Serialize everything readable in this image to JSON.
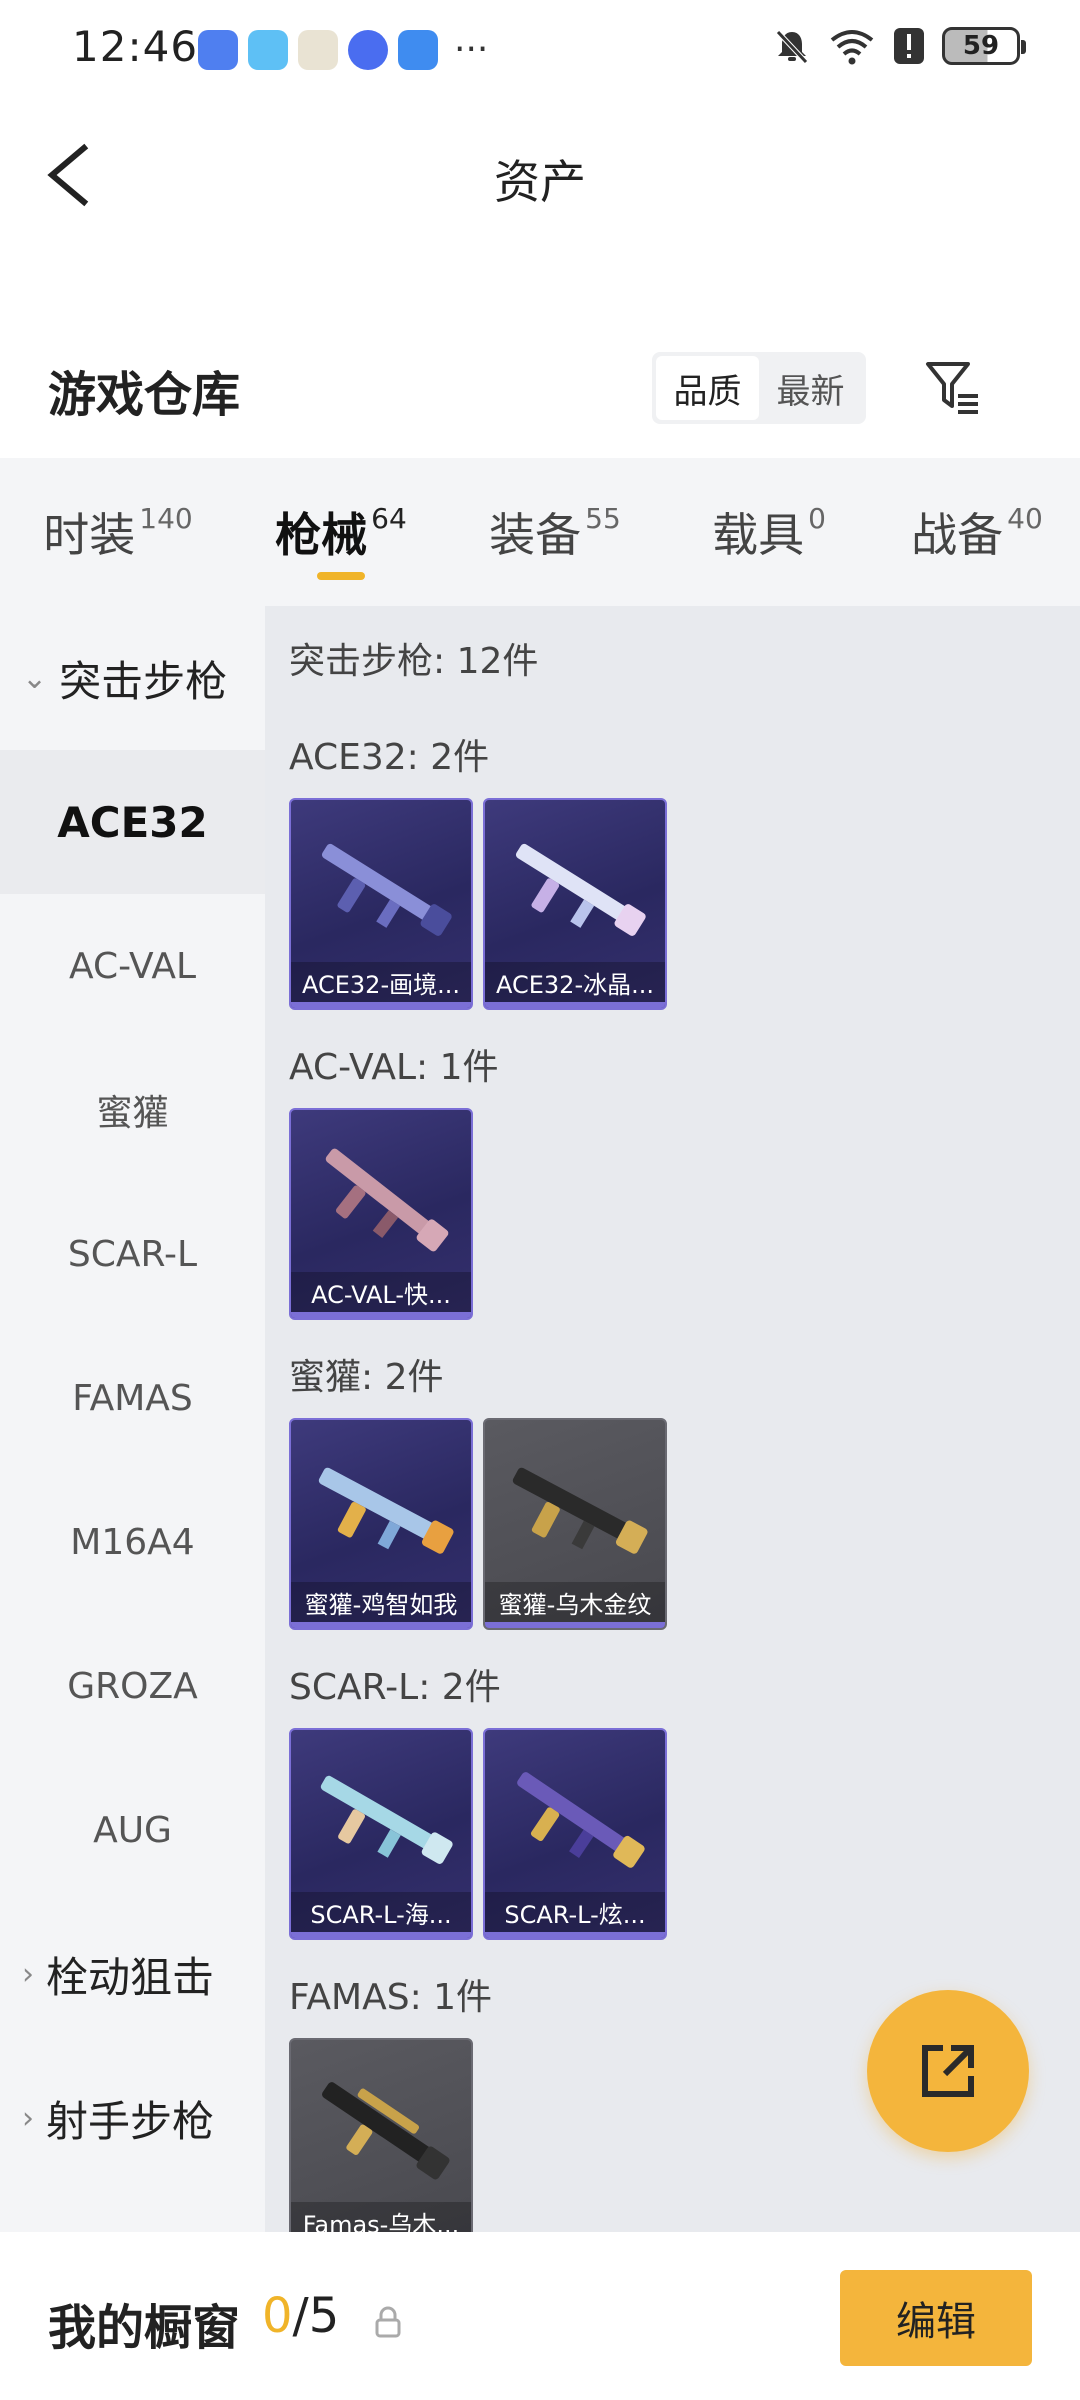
{
  "status_bar": {
    "time": "12:46",
    "battery": "59",
    "more": "···"
  },
  "header": {
    "title": "资产"
  },
  "warehouse": {
    "title": "游戏仓库",
    "sort_quality": "品质",
    "sort_latest": "最新"
  },
  "tabs": [
    {
      "label": "时装",
      "count": "140"
    },
    {
      "label": "枪械",
      "count": "64"
    },
    {
      "label": "装备",
      "count": "55"
    },
    {
      "label": "载具",
      "count": "0"
    },
    {
      "label": "战备",
      "count": "40"
    }
  ],
  "sidebar": {
    "group1": "突击步枪",
    "items": [
      "ACE32",
      "AC-VAL",
      "蜜獾",
      "SCAR-L",
      "FAMAS",
      "M16A4",
      "GROZA",
      "AUG"
    ],
    "group2": "栓动狙击",
    "group3": "射手步枪"
  },
  "content": {
    "summary": "突击步枪: 12件",
    "sections": [
      {
        "title": "ACE32: 2件",
        "items": [
          "ACE32-画境...",
          "ACE32-冰晶..."
        ]
      },
      {
        "title": "AC-VAL: 1件",
        "items": [
          "AC-VAL-快..."
        ]
      },
      {
        "title": "蜜獾: 2件",
        "items": [
          "蜜獾-鸡智如我",
          "蜜獾-乌木金纹"
        ]
      },
      {
        "title": "SCAR-L: 2件",
        "items": [
          "SCAR-L-海...",
          "SCAR-L-炫..."
        ]
      },
      {
        "title": "FAMAS: 1件",
        "items": [
          "Famas-乌木..."
        ]
      }
    ]
  },
  "bottom": {
    "title": "我的橱窗",
    "count_current": "0",
    "count_total": "/5",
    "edit": "编辑"
  },
  "colors": {
    "accent": "#f4b53c",
    "card_purple": "#2a2860",
    "card_gray": "#4e4e54"
  }
}
